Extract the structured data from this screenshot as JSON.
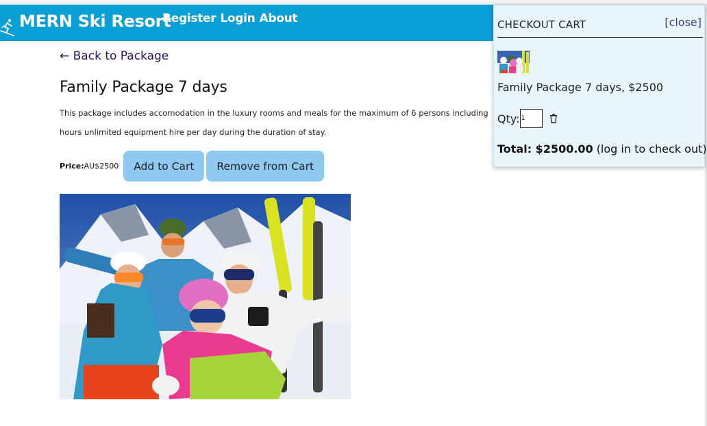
{
  "nav": {
    "brand": "MERN Ski Resort",
    "links": [
      "Register",
      "Login",
      "About"
    ]
  },
  "package": {
    "back_link": "← Back to Package",
    "title": "Family Package 7 days",
    "description_lines": [
      "This package includes accomodation in the luxury rooms and meals for the maximum of 6 persons including",
      "hours unlimited equipment hire per day during the duration of stay."
    ],
    "price_label": "Price:",
    "price_value": "AU$2500",
    "add_button": "Add to Cart",
    "remove_button": "Remove from Cart"
  },
  "cart": {
    "title": "CHECKOUT CART",
    "close_label": "[close]",
    "item_text": "Family Package 7 days, $2500",
    "qty_label": "Qty:",
    "qty_value": "1",
    "total_label": "Total: $2500.00",
    "total_note": "(log in to check out)"
  },
  "icons": {
    "logo": "skier-icon",
    "delete": "trash-icon"
  },
  "colors": {
    "navbar": "#0aa0d6",
    "button": "#8fc9f2",
    "cart_bg": "#e8f6fb",
    "link": "#2a1260"
  }
}
